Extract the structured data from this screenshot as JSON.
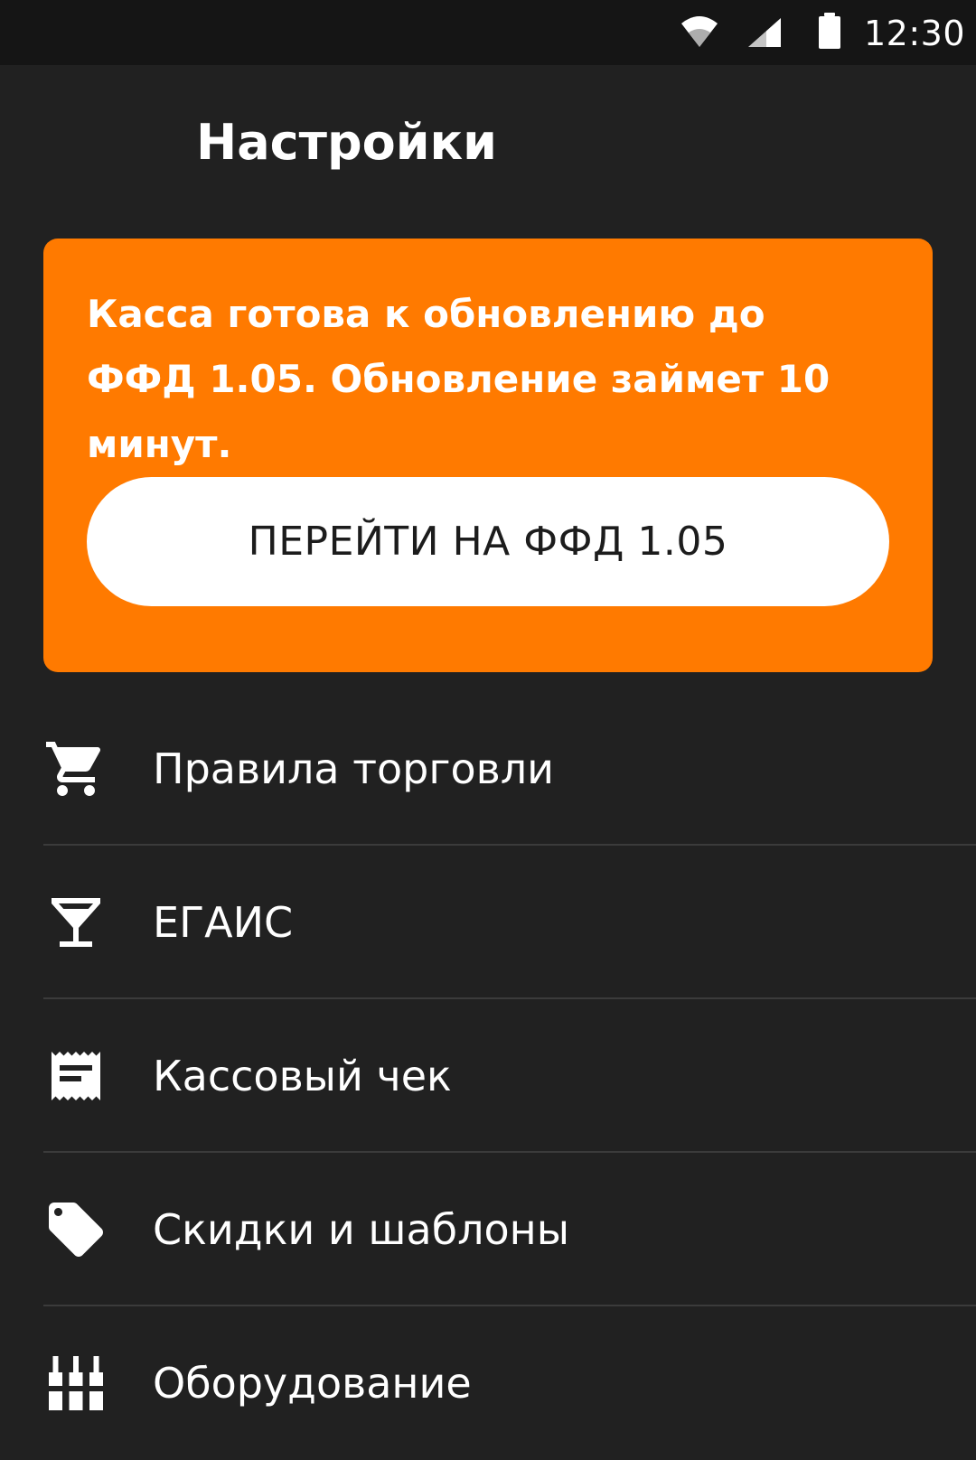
{
  "status_bar": {
    "time": "12:30",
    "icons": [
      "wifi-icon",
      "signal-icon",
      "battery-icon"
    ]
  },
  "header": {
    "title": "Настройки"
  },
  "banner": {
    "message": "Касса готова к обновлению до ФФД 1.05. Обновление займет 10 минут.",
    "button_label": "ПЕРЕЙТИ НА ФФД 1.05",
    "background_color": "#ff7a00"
  },
  "menu": {
    "items": [
      {
        "label": "Правила торговли",
        "icon": "cart-icon"
      },
      {
        "label": "ЕГАИС",
        "icon": "cocktail-glass-icon"
      },
      {
        "label": "Кассовый чек",
        "icon": "receipt-icon"
      },
      {
        "label": "Скидки и шаблоны",
        "icon": "tag-icon"
      },
      {
        "label": "Оборудование",
        "icon": "equipment-icon"
      }
    ]
  },
  "colors": {
    "background": "#212121",
    "status_bar": "#151515",
    "accent": "#ff7a00",
    "divider": "#3b3b3b"
  }
}
